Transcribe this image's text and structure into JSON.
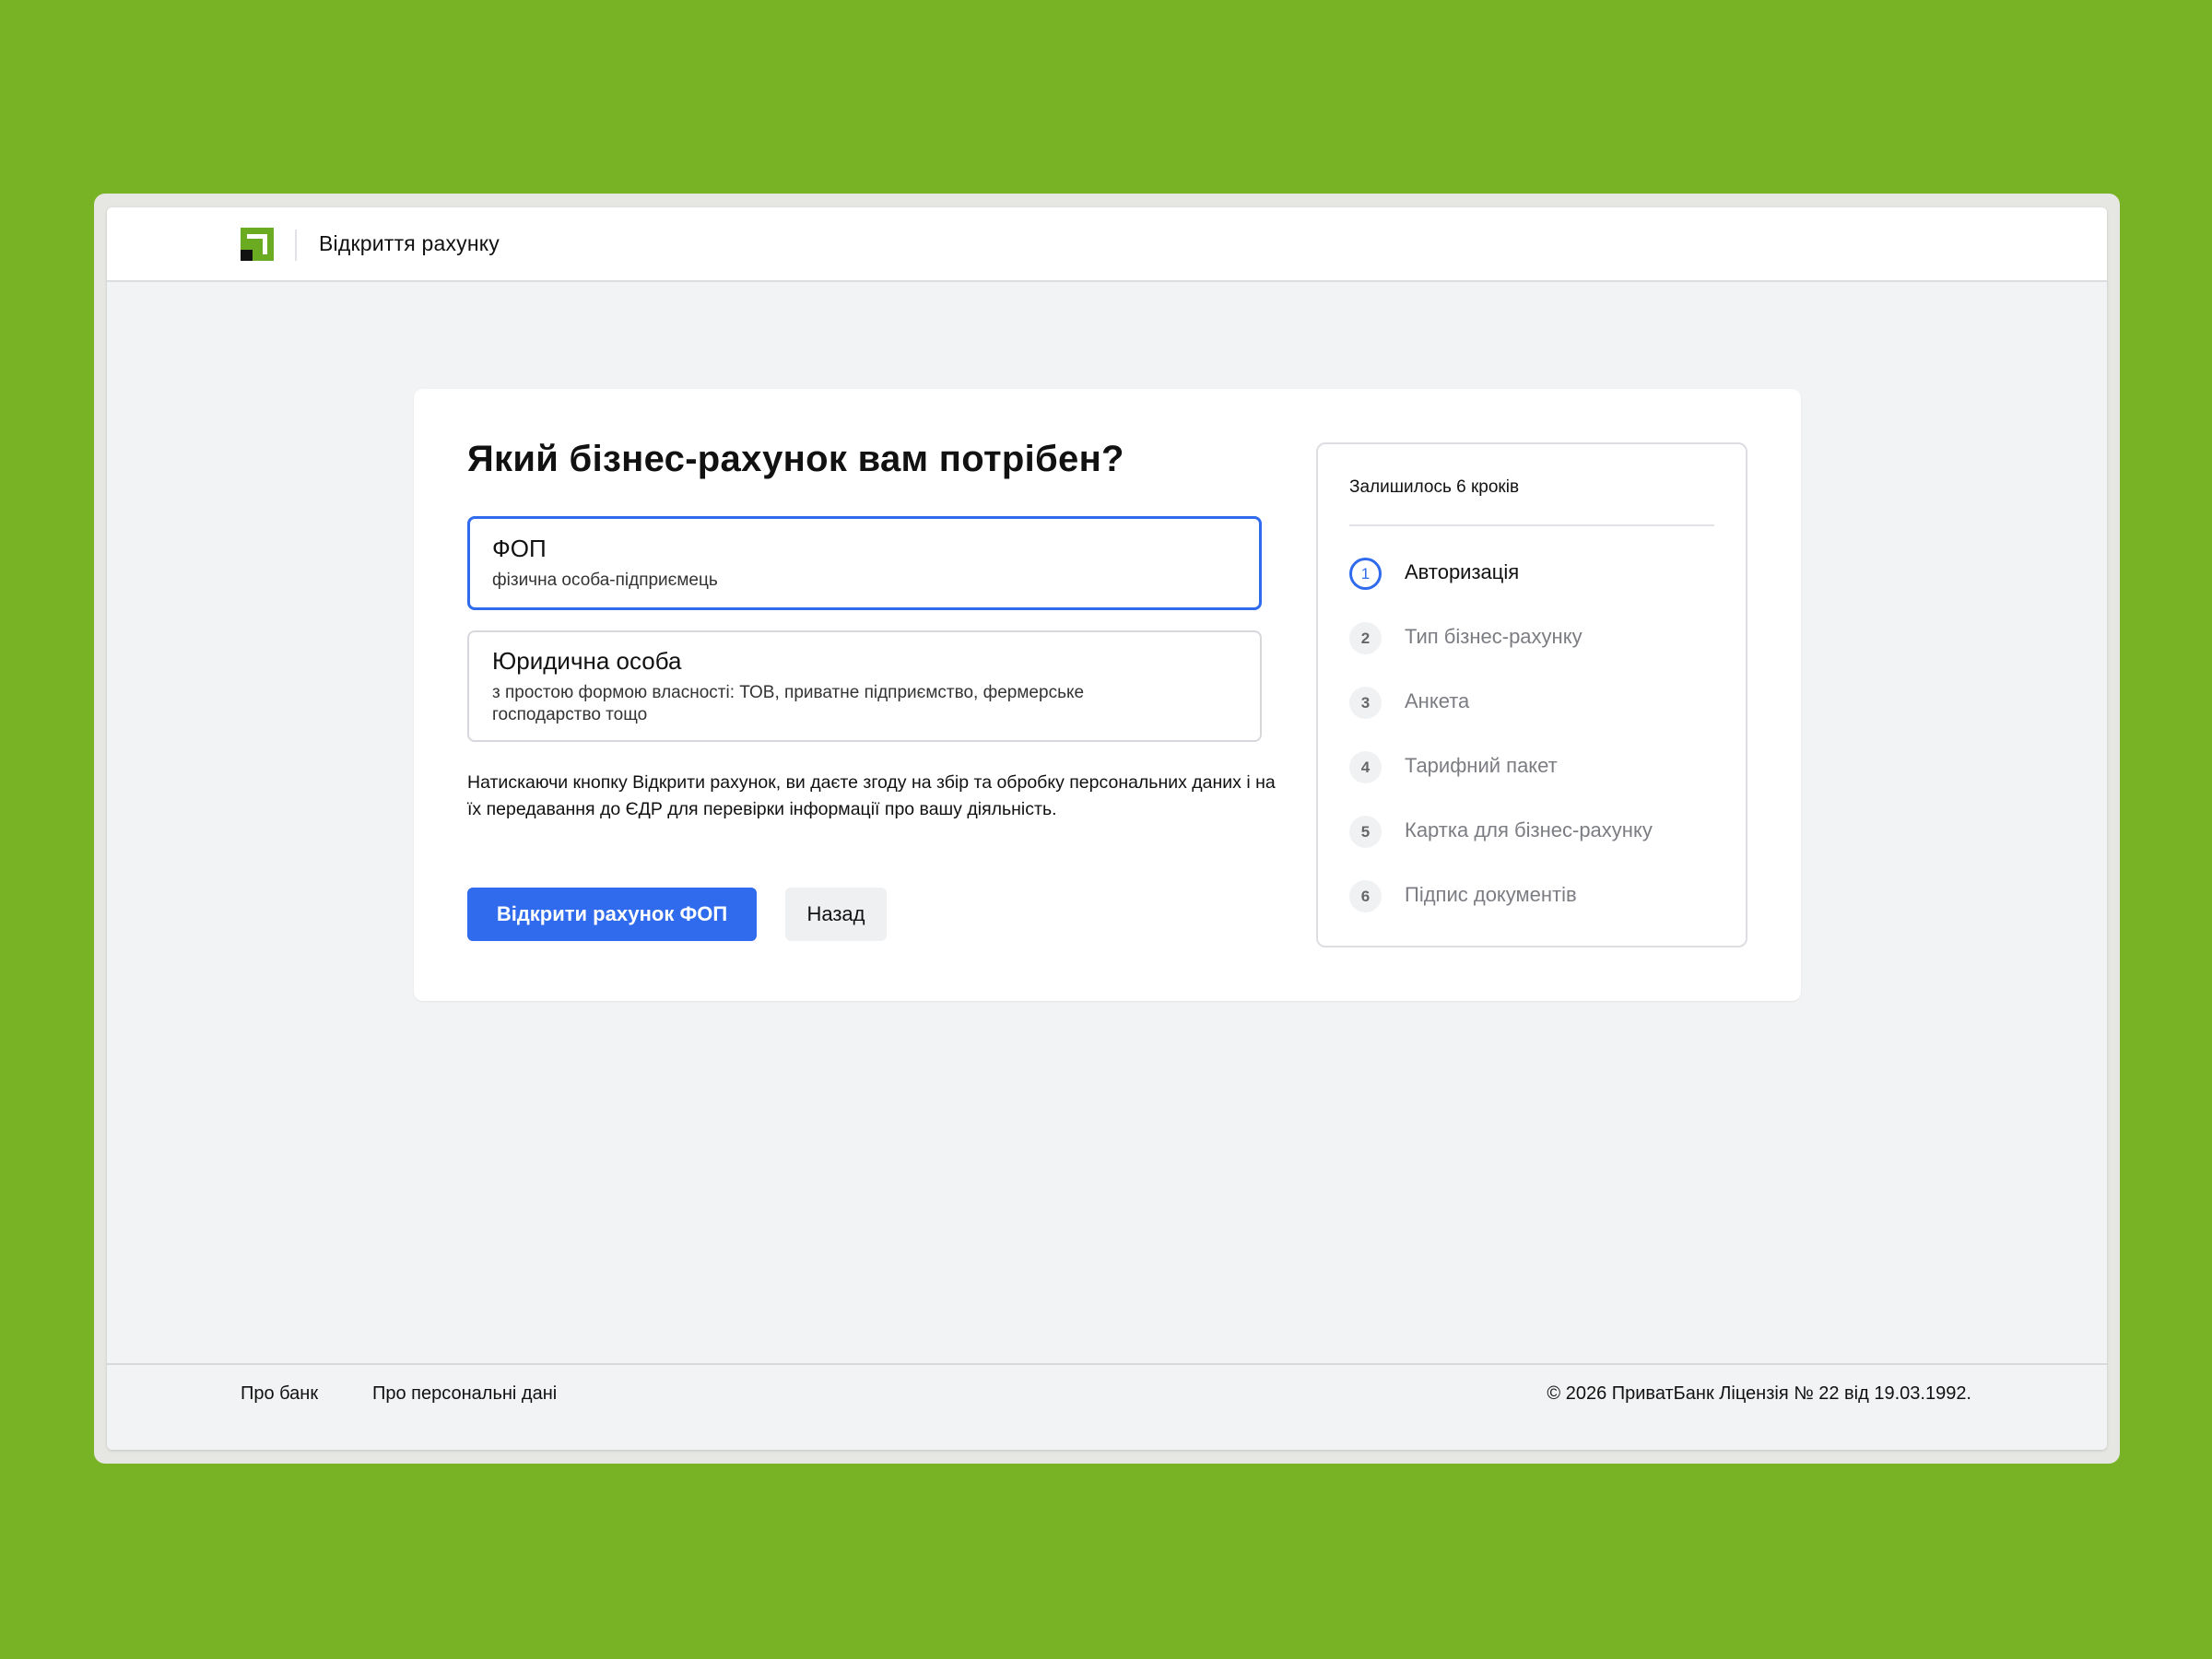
{
  "header": {
    "title": "Відкриття рахунку",
    "logo_icon": "privatbank-logo-icon",
    "brand_color": "#6bab22"
  },
  "main": {
    "heading": "Який бізнес-рахунок вам потрібен?",
    "options": [
      {
        "title": "ФОП",
        "subtitle": "фізична особа-підприємець",
        "selected": true
      },
      {
        "title": "Юридична особа",
        "subtitle": "з простою формою власності: ТОВ, приватне підприємство, фермерське господарство тощо",
        "selected": false
      }
    ],
    "consent_text": "Натискаючи кнопку Відкрити рахунок, ви даєте згоду на збір та обробку персональних даних і на їх передавання до ЄДР для перевірки інформації про вашу діяльність.",
    "primary_button": "Відкрити рахунок ФОП",
    "secondary_button": "Назад",
    "accent_color": "#2f6bec"
  },
  "steps": {
    "remaining": "Залишилось 6 кроків",
    "items": [
      {
        "number": "1",
        "label": "Авторизація",
        "active": true
      },
      {
        "number": "2",
        "label": "Тип бізнес-рахунку",
        "active": false
      },
      {
        "number": "3",
        "label": "Анкета",
        "active": false
      },
      {
        "number": "4",
        "label": "Тарифний пакет",
        "active": false
      },
      {
        "number": "5",
        "label": "Картка для бізнес-рахунку",
        "active": false
      },
      {
        "number": "6",
        "label": "Підпис документів",
        "active": false
      }
    ]
  },
  "footer": {
    "links": [
      "Про банк",
      "Про персональні дані"
    ],
    "copyright": "© 2026 ПриватБанк Ліцензія № 22 від 19.03.1992."
  }
}
